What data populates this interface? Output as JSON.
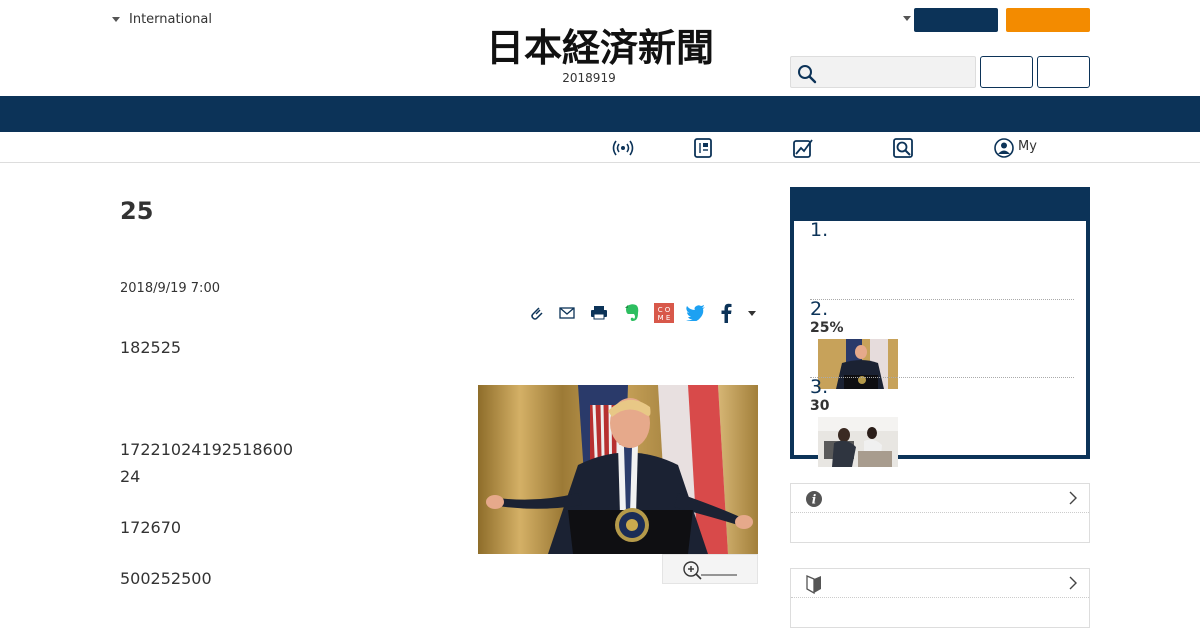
{
  "header": {
    "edition_label": "International",
    "logo_text": "日本経済新聞",
    "date": "2018919"
  },
  "subnav": {
    "my_label": "My"
  },
  "article": {
    "title": "25",
    "date": "2018/9/19 7:00",
    "paragraphs": [
      "182525",
      "17221024192518600",
      "24",
      "172670",
      "500252500"
    ]
  },
  "ranking": {
    "items": [
      {
        "number": "1.",
        "subtitle": ""
      },
      {
        "number": "2.",
        "subtitle": "25%"
      },
      {
        "number": "3.",
        "subtitle": "30"
      }
    ]
  },
  "colors": {
    "navy": "#0c3358",
    "orange": "#f38b00",
    "notification": "#e60012"
  },
  "icons": [
    "caret-down-icon",
    "search-icon",
    "live-broadcast-icon",
    "paper-edition-icon",
    "market-chart-icon",
    "news-search-icon",
    "user-icon",
    "clip-icon",
    "mail-icon",
    "print-icon",
    "evernote-icon",
    "come-icon",
    "twitter-icon",
    "facebook-icon",
    "zoom-in-icon",
    "info-icon",
    "beginner-mark-icon",
    "chevron-right-icon"
  ]
}
